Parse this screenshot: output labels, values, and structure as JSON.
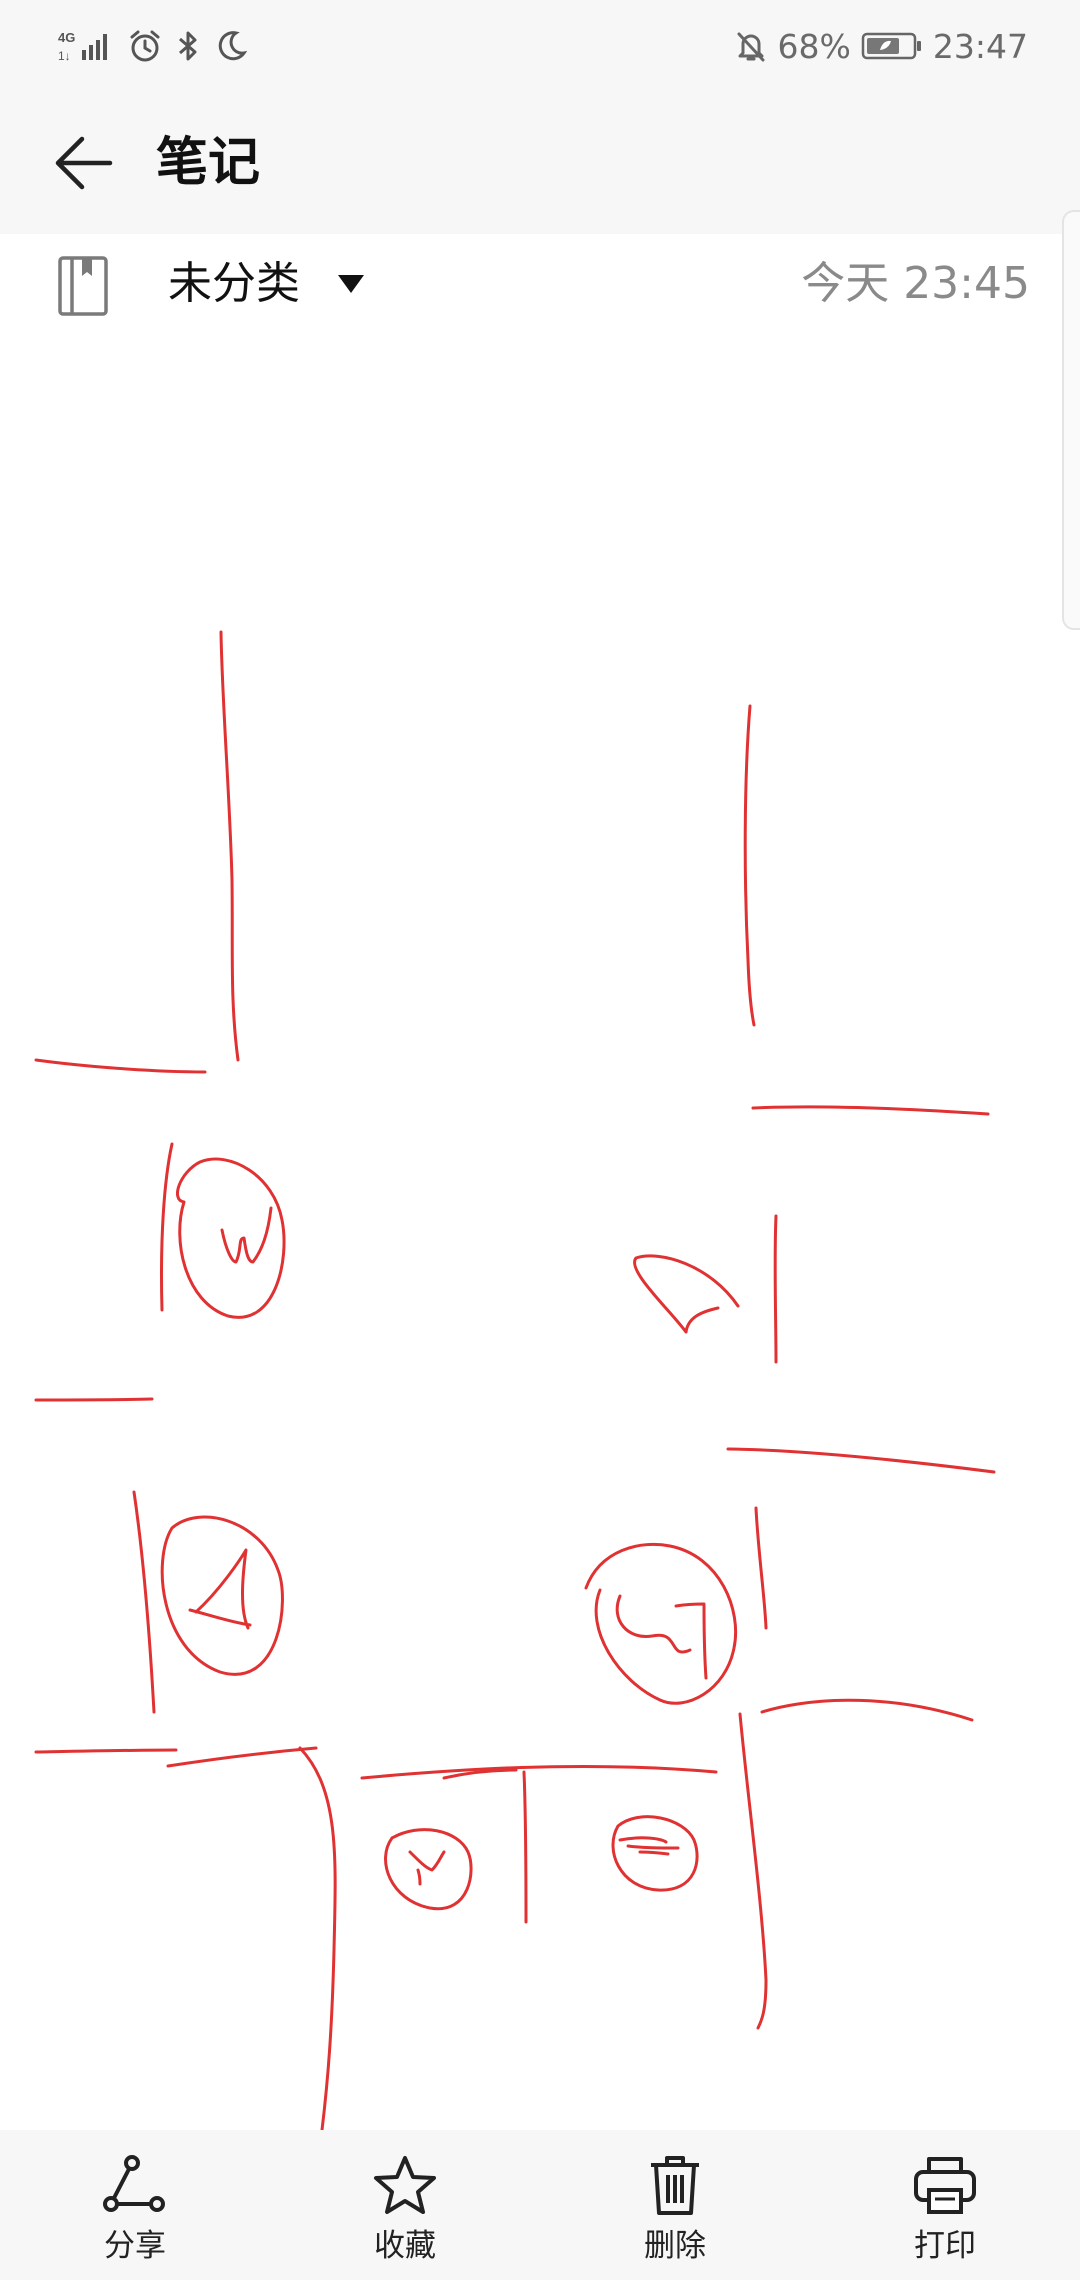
{
  "status_bar": {
    "network_type": "4G",
    "battery_percent": "68%",
    "time": "23:47",
    "icons": [
      "signal-icon",
      "alarm-icon",
      "bluetooth-icon",
      "moon-icon",
      "bell-muted-icon",
      "battery-icon"
    ]
  },
  "header": {
    "title": "笔记"
  },
  "note": {
    "category": "未分类",
    "date": "今天 23:45",
    "ink_color": "#e03232"
  },
  "actions": [
    {
      "label": "分享",
      "icon": "share-icon"
    },
    {
      "label": "收藏",
      "icon": "star-icon"
    },
    {
      "label": "删除",
      "icon": "trash-icon"
    },
    {
      "label": "打印",
      "icon": "printer-icon"
    }
  ]
}
